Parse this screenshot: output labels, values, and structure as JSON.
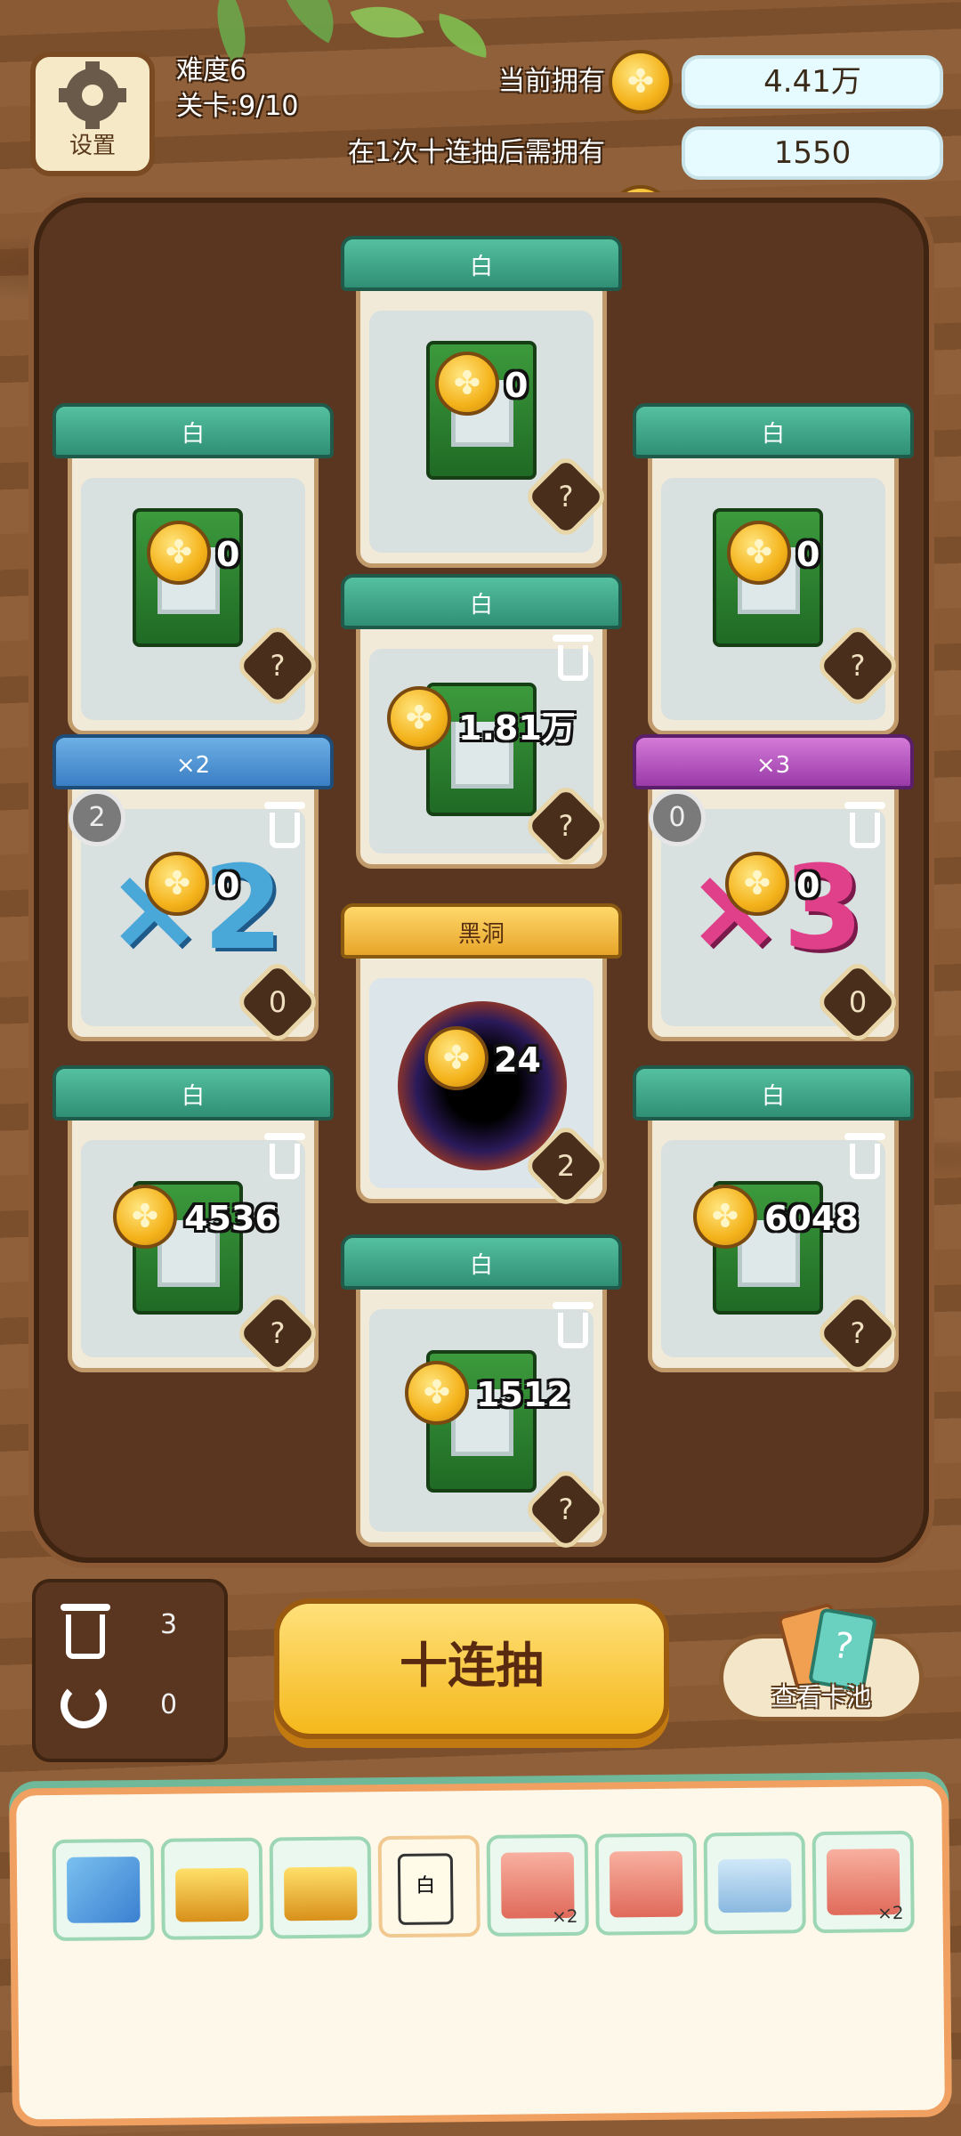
{
  "header": {
    "settings_label": "设置",
    "difficulty": "难度6",
    "level": "关卡:9/10",
    "current_label": "当前拥有",
    "current_value": "4.41万",
    "need_label": "在1次十连抽后需拥有",
    "need_value": "1550"
  },
  "cards": [
    {
      "id": "top-center",
      "title": "白",
      "coin": "0",
      "badge": "?"
    },
    {
      "id": "mid-left-1",
      "title": "白",
      "coin": "0",
      "badge": "?"
    },
    {
      "id": "mid-right-1",
      "title": "白",
      "coin": "0",
      "badge": "?"
    },
    {
      "id": "center-2",
      "title": "白",
      "coin": "1.81万",
      "badge": "?"
    },
    {
      "id": "x2",
      "title": "×2",
      "coin": "0",
      "badge": "0",
      "circle": "2",
      "big": "×2"
    },
    {
      "id": "x3",
      "title": "×3",
      "coin": "0",
      "badge": "0",
      "circle": "0",
      "big": "×3"
    },
    {
      "id": "blackhole",
      "title": "黑洞",
      "coin": "24",
      "badge": "2"
    },
    {
      "id": "bot-left",
      "title": "白",
      "coin": "4536",
      "badge": "?"
    },
    {
      "id": "bot-right",
      "title": "白",
      "coin": "6048",
      "badge": "?"
    },
    {
      "id": "bottom-center",
      "title": "白",
      "coin": "1512",
      "badge": "?"
    }
  ],
  "stats": {
    "trash_count": "3",
    "undo_count": "0"
  },
  "draw_button": "十连抽",
  "pool_button": "查看卡池",
  "items": [
    {
      "name": "card-pack-icon",
      "label": ""
    },
    {
      "name": "golden-chest-icon",
      "label": ""
    },
    {
      "name": "golden-chest-icon",
      "label": ""
    },
    {
      "name": "white-card-upgrade-icon",
      "label": "白"
    },
    {
      "name": "cards-x2-icon",
      "label": "×2"
    },
    {
      "name": "cards-coin-icon",
      "label": ""
    },
    {
      "name": "screen-gem-icon",
      "label": ""
    },
    {
      "name": "cards-x2-icon",
      "label": "×2"
    }
  ],
  "colors": {
    "coin": "#f4b21a",
    "accent": "#f5b81c",
    "board": "#5a3520"
  }
}
